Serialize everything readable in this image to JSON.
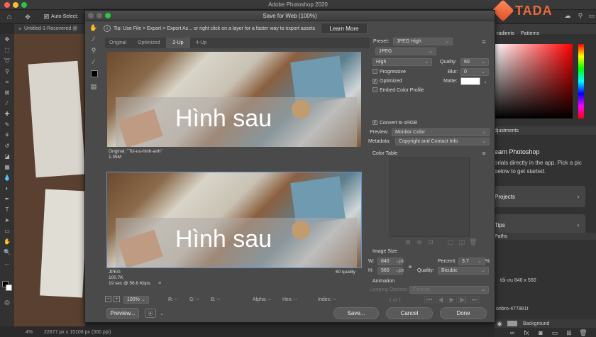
{
  "app": {
    "window_title": "Adobe Photoshop 2020",
    "auto_select": "Auto-Select:"
  },
  "document": {
    "tab_title": "Untitled-1-Recovered @",
    "zoom": "4%",
    "size": "22677 px x 15106 px (300 ppi)"
  },
  "logo": {
    "text": "TADA"
  },
  "right_panel": {
    "tab_gradients": "radients",
    "tab_patterns": "Patterns",
    "adjustments": "djustments",
    "learn_title": "earn Photoshop",
    "learn_desc": "orials directly in the app. Pick a pic below to get started.",
    "card_projects": "Projects",
    "card_tips": "Tips",
    "paths_tab": "Paths",
    "layer_name": "Background",
    "layer_sub": "tối ưu 840 x 560",
    "layer_sub2": "onbro-477881t"
  },
  "dialog": {
    "title": "Save for Web (100%)",
    "tip": "Tip: Use File > Export > Export As...  or right click on a layer for a faster way to export assets",
    "learn_more": "Learn More",
    "tabs": [
      "Original",
      "Optimized",
      "2-Up",
      "4-Up"
    ],
    "active_tab": "2-Up",
    "top_image": {
      "overlay": "Hình sau",
      "info_line1": "Original: \"Toi-uu-hinh-anh\"",
      "info_line2": "1.35M"
    },
    "bottom_image": {
      "overlay": "Hình sau",
      "info_line1": "JPEG",
      "info_line2": "100.7K",
      "info_line3": "19 sec @ 56.6 Kbps",
      "quality": "60 quality"
    },
    "zoom": "100%",
    "readouts": {
      "r": "R: --",
      "g": "G: --",
      "b": "B: --",
      "alpha": "Alpha: --",
      "hex": "Hex: --",
      "index": "Index: --"
    },
    "preview_button": "Preview...",
    "save_button": "Save...",
    "cancel_button": "Cancel",
    "done_button": "Done",
    "settings": {
      "preset_label": "Preset:",
      "preset_value": "JPEG High",
      "format": "JPEG",
      "compression": "High",
      "quality_label": "Quality:",
      "quality_value": "60",
      "progressive": "Progressive",
      "blur_label": "Blur:",
      "blur_value": "0",
      "optimized": "Optimized",
      "matte_label": "Matte:",
      "embed_profile": "Embed Color Profile",
      "convert_srgb": "Convert to sRGB",
      "preview_label": "Preview:",
      "preview_value": "Monitor Color",
      "metadata_label": "Metadata:",
      "metadata_value": "Copyright and Contact Info",
      "color_table": "Color Table",
      "image_size": "Image Size",
      "w_label": "W:",
      "w_value": "840",
      "h_label": "H:",
      "h_value": "560",
      "unit": "px",
      "percent_label": "Percent:",
      "percent_value": "3.7",
      "percent_unit": "%",
      "resample_label": "Quality:",
      "resample_value": "Bicubic",
      "animation": "Animation",
      "looping_label": "Looping Options:",
      "looping_value": "Forever",
      "frame_counter": "1 of 1"
    }
  }
}
